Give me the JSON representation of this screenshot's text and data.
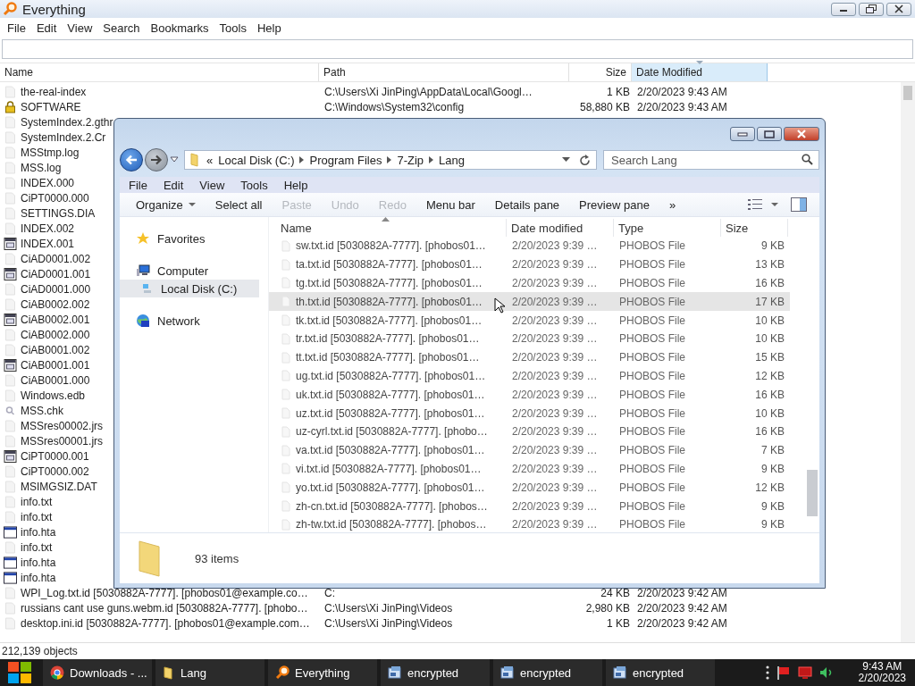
{
  "everything": {
    "title": "Everything",
    "menu": [
      "File",
      "Edit",
      "View",
      "Search",
      "Bookmarks",
      "Tools",
      "Help"
    ],
    "columns": [
      {
        "label": "Name",
        "selected": false
      },
      {
        "label": "Path",
        "selected": false
      },
      {
        "label": "Size",
        "selected": false
      },
      {
        "label": "Date Modified",
        "selected": true
      }
    ],
    "rows": [
      {
        "name": "the-real-index",
        "kind": "file",
        "path": "C:\\Users\\Xi JinPing\\AppData\\Local\\Googl…",
        "size": "1 KB",
        "date": "2/20/2023 9:43 AM"
      },
      {
        "name": "SOFTWARE",
        "kind": "lock",
        "path": "C:\\Windows\\System32\\config",
        "size": "58,880 KB",
        "date": "2/20/2023 9:43 AM"
      },
      {
        "name": "SystemIndex.2.gthr",
        "kind": "file"
      },
      {
        "name": "SystemIndex.2.Cr",
        "kind": "file"
      },
      {
        "name": "MSStmp.log",
        "kind": "file"
      },
      {
        "name": "MSS.log",
        "kind": "file"
      },
      {
        "name": "INDEX.000",
        "kind": "file"
      },
      {
        "name": "CiPT0000.000",
        "kind": "file"
      },
      {
        "name": "SETTINGS.DIA",
        "kind": "file"
      },
      {
        "name": "INDEX.002",
        "kind": "file"
      },
      {
        "name": "INDEX.001",
        "kind": "app"
      },
      {
        "name": "CiAD0001.002",
        "kind": "file"
      },
      {
        "name": "CiAD0001.001",
        "kind": "app"
      },
      {
        "name": "CiAD0001.000",
        "kind": "file"
      },
      {
        "name": "CiAB0002.002",
        "kind": "file"
      },
      {
        "name": "CiAB0002.001",
        "kind": "app"
      },
      {
        "name": "CiAB0002.000",
        "kind": "file"
      },
      {
        "name": "CiAB0001.002",
        "kind": "file"
      },
      {
        "name": "CiAB0001.001",
        "kind": "app"
      },
      {
        "name": "CiAB0001.000",
        "kind": "file"
      },
      {
        "name": "Windows.edb",
        "kind": "file"
      },
      {
        "name": "MSS.chk",
        "kind": "chk"
      },
      {
        "name": "MSSres00002.jrs",
        "kind": "file"
      },
      {
        "name": "MSSres00001.jrs",
        "kind": "file"
      },
      {
        "name": "CiPT0000.001",
        "kind": "app"
      },
      {
        "name": "CiPT0000.002",
        "kind": "file"
      },
      {
        "name": "MSIMGSIZ.DAT",
        "kind": "file"
      },
      {
        "name": "info.txt",
        "kind": "file"
      },
      {
        "name": "info.txt",
        "kind": "file"
      },
      {
        "name": "info.hta",
        "kind": "hta"
      },
      {
        "name": "info.txt",
        "kind": "file"
      },
      {
        "name": "info.hta",
        "kind": "hta"
      },
      {
        "name": "info.hta",
        "kind": "hta"
      },
      {
        "name": "WPI_Log.txt.id [5030882A-7777]. [phobos01@example.co…",
        "kind": "file",
        "path": "C:",
        "size": "24 KB",
        "date": "2/20/2023 9:42 AM"
      },
      {
        "name": "russians cant use guns.webm.id [5030882A-7777]. [phobo…",
        "kind": "file",
        "path": "C:\\Users\\Xi JinPing\\Videos",
        "size": "2,980 KB",
        "date": "2/20/2023 9:42 AM"
      },
      {
        "name": "desktop.ini.id [5030882A-7777]. [phobos01@example.com…",
        "kind": "file",
        "path": "C:\\Users\\Xi JinPing\\Videos",
        "size": "1 KB",
        "date": "2/20/2023 9:42 AM"
      }
    ],
    "status": "212,139 objects"
  },
  "explorer": {
    "breadcrumb_overflow": "«",
    "breadcrumb": [
      "Local Disk (C:)",
      "Program Files",
      "7-Zip",
      "Lang"
    ],
    "search": {
      "placeholder": "Search Lang"
    },
    "menu": [
      "File",
      "Edit",
      "View",
      "Tools",
      "Help"
    ],
    "commands": [
      {
        "label": "Organize",
        "kind": "dropdown",
        "disabled": false
      },
      {
        "label": "Select all",
        "kind": "plain",
        "disabled": false
      },
      {
        "label": "Paste",
        "kind": "plain",
        "disabled": true
      },
      {
        "label": "Undo",
        "kind": "plain",
        "disabled": true
      },
      {
        "label": "Redo",
        "kind": "plain",
        "disabled": true
      },
      {
        "label": "Menu bar",
        "kind": "plain",
        "disabled": false
      },
      {
        "label": "Details pane",
        "kind": "plain",
        "disabled": false
      },
      {
        "label": "Preview pane",
        "kind": "plain",
        "disabled": false
      },
      {
        "label": "»",
        "kind": "overflow",
        "disabled": false
      }
    ],
    "nav": [
      {
        "label": "Favorites",
        "kind": "star",
        "selected": false
      },
      {
        "label": "Computer",
        "kind": "computer",
        "selected": false,
        "children": [
          {
            "label": "Local Disk (C:)",
            "kind": "drive",
            "selected": true
          }
        ]
      },
      {
        "label": "Network",
        "kind": "globe",
        "selected": false
      }
    ],
    "columns": [
      "Name",
      "Date modified",
      "Type",
      "Size"
    ],
    "files": [
      {
        "name": "sw.txt.id [5030882A-7777]. [phobos01…",
        "date": "2/20/2023 9:39 …",
        "type": "PHOBOS File",
        "size": "9 KB",
        "selected": false
      },
      {
        "name": "ta.txt.id [5030882A-7777]. [phobos01…",
        "date": "2/20/2023 9:39 …",
        "type": "PHOBOS File",
        "size": "13 KB",
        "selected": false
      },
      {
        "name": "tg.txt.id [5030882A-7777]. [phobos01…",
        "date": "2/20/2023 9:39 …",
        "type": "PHOBOS File",
        "size": "16 KB",
        "selected": false
      },
      {
        "name": "th.txt.id [5030882A-7777]. [phobos01…",
        "date": "2/20/2023 9:39 …",
        "type": "PHOBOS File",
        "size": "17 KB",
        "selected": true
      },
      {
        "name": "tk.txt.id [5030882A-7777]. [phobos01…",
        "date": "2/20/2023 9:39 …",
        "type": "PHOBOS File",
        "size": "10 KB",
        "selected": false
      },
      {
        "name": "tr.txt.id [5030882A-7777]. [phobos01…",
        "date": "2/20/2023 9:39 …",
        "type": "PHOBOS File",
        "size": "10 KB",
        "selected": false
      },
      {
        "name": "tt.txt.id [5030882A-7777]. [phobos01…",
        "date": "2/20/2023 9:39 …",
        "type": "PHOBOS File",
        "size": "15 KB",
        "selected": false
      },
      {
        "name": "ug.txt.id [5030882A-7777]. [phobos01…",
        "date": "2/20/2023 9:39 …",
        "type": "PHOBOS File",
        "size": "12 KB",
        "selected": false
      },
      {
        "name": "uk.txt.id [5030882A-7777]. [phobos01…",
        "date": "2/20/2023 9:39 …",
        "type": "PHOBOS File",
        "size": "16 KB",
        "selected": false
      },
      {
        "name": "uz.txt.id [5030882A-7777]. [phobos01…",
        "date": "2/20/2023 9:39 …",
        "type": "PHOBOS File",
        "size": "10 KB",
        "selected": false
      },
      {
        "name": "uz-cyrl.txt.id [5030882A-7777]. [phobo…",
        "date": "2/20/2023 9:39 …",
        "type": "PHOBOS File",
        "size": "16 KB",
        "selected": false
      },
      {
        "name": "va.txt.id [5030882A-7777]. [phobos01…",
        "date": "2/20/2023 9:39 …",
        "type": "PHOBOS File",
        "size": "7 KB",
        "selected": false
      },
      {
        "name": "vi.txt.id [5030882A-7777]. [phobos01…",
        "date": "2/20/2023 9:39 …",
        "type": "PHOBOS File",
        "size": "9 KB",
        "selected": false
      },
      {
        "name": "yo.txt.id [5030882A-7777]. [phobos01…",
        "date": "2/20/2023 9:39 …",
        "type": "PHOBOS File",
        "size": "12 KB",
        "selected": false
      },
      {
        "name": "zh-cn.txt.id [5030882A-7777]. [phobos…",
        "date": "2/20/2023 9:39 …",
        "type": "PHOBOS File",
        "size": "9 KB",
        "selected": false
      },
      {
        "name": "zh-tw.txt.id [5030882A-7777]. [phobos…",
        "date": "2/20/2023 9:39 …",
        "type": "PHOBOS File",
        "size": "9 KB",
        "selected": false
      }
    ],
    "item_count": "93 items"
  },
  "taskbar": {
    "items": [
      {
        "label": "Downloads - ...",
        "kind": "browser"
      },
      {
        "label": "Lang",
        "kind": "folder"
      },
      {
        "label": "Everything",
        "kind": "magnifier"
      },
      {
        "label": "encrypted",
        "kind": "program"
      },
      {
        "label": "encrypted",
        "kind": "program"
      },
      {
        "label": "encrypted",
        "kind": "program"
      }
    ],
    "clock_time": "9:43 AM",
    "clock_date": "2/20/2023"
  }
}
